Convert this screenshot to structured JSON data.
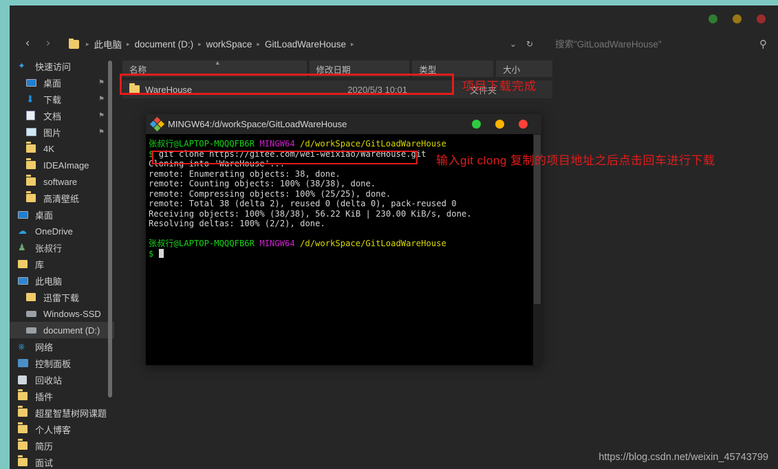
{
  "window": {
    "controls": [
      {
        "name": "minimize",
        "color": "#2f7d32"
      },
      {
        "name": "maximize",
        "color": "#9a7714"
      },
      {
        "name": "close",
        "color": "#9c2c2c"
      }
    ]
  },
  "nav": {
    "back_icon": "‹",
    "forward_icon": "›",
    "dropdown_icon": "⌄",
    "refresh_icon": "↻"
  },
  "breadcrumb": {
    "items": [
      "此电脑",
      "document (D:)",
      "workSpace",
      "GitLoadWareHouse"
    ],
    "separator": "▸"
  },
  "search": {
    "placeholder": "搜索\"GitLoadWareHouse\"",
    "icon": "⚲"
  },
  "sidebar": {
    "items": [
      {
        "label": "快速访问",
        "icon": "star-icon",
        "indent": 0,
        "pinned": false,
        "selected": false
      },
      {
        "label": "桌面",
        "icon": "desktop-icon",
        "indent": 1,
        "pinned": true,
        "selected": false
      },
      {
        "label": "下载",
        "icon": "download-icon",
        "indent": 1,
        "pinned": true,
        "selected": false
      },
      {
        "label": "文档",
        "icon": "document-icon",
        "indent": 1,
        "pinned": true,
        "selected": false
      },
      {
        "label": "图片",
        "icon": "pictures-icon",
        "indent": 1,
        "pinned": true,
        "selected": false
      },
      {
        "label": "4K",
        "icon": "folder-icon",
        "indent": 1,
        "pinned": false,
        "selected": false
      },
      {
        "label": "IDEAImage",
        "icon": "folder-icon",
        "indent": 1,
        "pinned": false,
        "selected": false
      },
      {
        "label": "software",
        "icon": "folder-icon",
        "indent": 1,
        "pinned": false,
        "selected": false
      },
      {
        "label": "高清壁纸",
        "icon": "folder-icon",
        "indent": 1,
        "pinned": false,
        "selected": false
      },
      {
        "label": "桌面",
        "icon": "desktop-icon",
        "indent": 0,
        "pinned": false,
        "selected": false
      },
      {
        "label": "OneDrive",
        "icon": "onedrive-icon",
        "indent": 0,
        "pinned": false,
        "selected": false
      },
      {
        "label": "张叔行",
        "icon": "user-icon",
        "indent": 0,
        "pinned": false,
        "selected": false
      },
      {
        "label": "库",
        "icon": "library-icon",
        "indent": 0,
        "pinned": false,
        "selected": false
      },
      {
        "label": "此电脑",
        "icon": "this-pc-icon",
        "indent": 0,
        "pinned": false,
        "selected": false
      },
      {
        "label": "迅雷下载",
        "icon": "thunder-folder-icon",
        "indent": 1,
        "pinned": false,
        "selected": false
      },
      {
        "label": "Windows-SSD",
        "icon": "drive-icon",
        "indent": 1,
        "pinned": false,
        "selected": false
      },
      {
        "label": "document (D:)",
        "icon": "drive-icon",
        "indent": 1,
        "pinned": false,
        "selected": true
      },
      {
        "label": "网络",
        "icon": "network-icon",
        "indent": 0,
        "pinned": false,
        "selected": false
      },
      {
        "label": "控制面板",
        "icon": "control-panel-icon",
        "indent": 0,
        "pinned": false,
        "selected": false
      },
      {
        "label": "回收站",
        "icon": "recycle-bin-icon",
        "indent": 0,
        "pinned": false,
        "selected": false
      },
      {
        "label": "插件",
        "icon": "folder-icon",
        "indent": 0,
        "pinned": false,
        "selected": false
      },
      {
        "label": "超星智慧树网课题",
        "icon": "folder-icon",
        "indent": 0,
        "pinned": false,
        "selected": false
      },
      {
        "label": "个人博客",
        "icon": "folder-icon",
        "indent": 0,
        "pinned": false,
        "selected": false
      },
      {
        "label": "简历",
        "icon": "folder-icon",
        "indent": 0,
        "pinned": false,
        "selected": false
      },
      {
        "label": "面试",
        "icon": "folder-icon",
        "indent": 0,
        "pinned": false,
        "selected": false
      }
    ],
    "pin_glyph": "⚑"
  },
  "filelist": {
    "columns": [
      "名称",
      "修改日期",
      "类型",
      "大小"
    ],
    "sort_arrow": "▲",
    "rows": [
      {
        "name": "WareHouse",
        "date": "2020/5/3 10:01",
        "type": "文件夹",
        "size": ""
      }
    ]
  },
  "annotations": {
    "row": "项目下载完成",
    "command": "输入git clong 复制的项目地址之后点击回车进行下载",
    "color": "#e41b1b"
  },
  "terminal": {
    "title": "MINGW64:/d/workSpace/GitLoadWareHouse",
    "controls": [
      {
        "name": "minimize",
        "color": "#2ecc40"
      },
      {
        "name": "maximize",
        "color": "#ffb400"
      },
      {
        "name": "close",
        "color": "#ff4136"
      }
    ],
    "prompt_user": "张叔行@LAPTOP-MQQQFB6R",
    "prompt_shell": "MINGW64",
    "prompt_path": "/d/workSpace/GitLoadWareHouse",
    "prompt_symbol": "$",
    "command": "git clone https://gitee.com/wei-weixiao/WareHouse.git",
    "output": [
      "Cloning into 'WareHouse'...",
      "remote: Enumerating objects: 38, done.",
      "remote: Counting objects: 100% (38/38), done.",
      "remote: Compressing objects: 100% (25/25), done.",
      "remote: Total 38 (delta 2), reused 0 (delta 0), pack-reused 0",
      "Receiving objects: 100% (38/38), 56.22 KiB | 230.00 KiB/s, done.",
      "Resolving deltas: 100% (2/2), done."
    ]
  },
  "watermark": "https://blog.csdn.net/weixin_45743799"
}
